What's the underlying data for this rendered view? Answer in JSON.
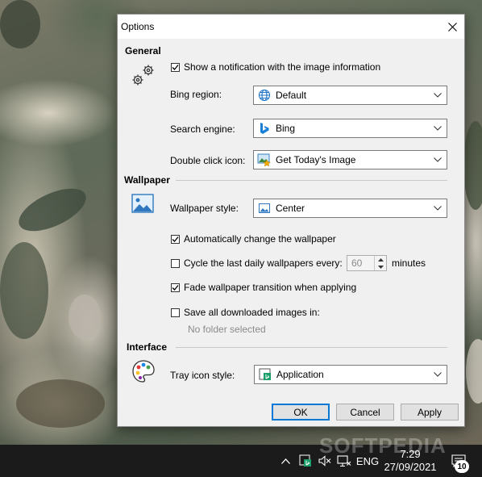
{
  "dialog": {
    "title": "Options",
    "footer": {
      "ok_label": "OK",
      "cancel_label": "Cancel",
      "apply_label": "Apply"
    }
  },
  "general": {
    "section_label": "General",
    "show_notification": {
      "label": "Show a notification with the image information",
      "checked": true
    },
    "bing_region": {
      "label": "Bing region:",
      "value": "Default",
      "icon": "globe-icon"
    },
    "search_engine": {
      "label": "Search engine:",
      "value": "Bing",
      "icon": "bing-icon"
    },
    "double_click_icon": {
      "label": "Double click icon:",
      "value": "Get Today's Image",
      "icon": "image-star-icon"
    }
  },
  "wallpaper": {
    "section_label": "Wallpaper",
    "style": {
      "label": "Wallpaper style:",
      "value": "Center",
      "icon": "picture-icon"
    },
    "auto_change": {
      "label": "Automatically change the wallpaper",
      "checked": true
    },
    "cycle": {
      "label": "Cycle the last daily wallpapers every:",
      "checked": false,
      "value": "60",
      "unit": "minutes"
    },
    "fade": {
      "label": "Fade wallpaper transition when applying",
      "checked": true
    },
    "save_all": {
      "label": "Save all downloaded images in:",
      "checked": false,
      "folder": "No folder selected"
    }
  },
  "interface": {
    "section_label": "Interface",
    "tray_icon_style": {
      "label": "Tray icon style:",
      "value": "Application",
      "icon": "app-icon"
    }
  },
  "taskbar": {
    "language": "ENG",
    "time": "7:29",
    "date": "27/09/2021",
    "notification_count": "10",
    "watermark": "SOFTPEDIA"
  }
}
